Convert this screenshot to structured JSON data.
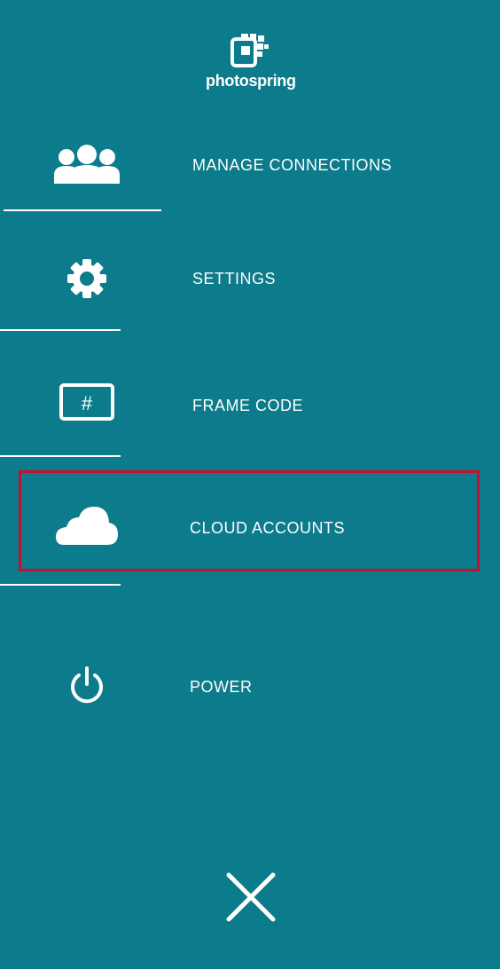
{
  "app": {
    "brand": "photospring"
  },
  "menu": {
    "items": [
      {
        "label": "MANAGE CONNECTIONS",
        "icon": "users-icon"
      },
      {
        "label": "SETTINGS",
        "icon": "gear-icon"
      },
      {
        "label": "FRAME CODE",
        "icon": "frame-code-icon"
      },
      {
        "label": "CLOUD ACCOUNTS",
        "icon": "cloud-icon",
        "highlighted": true
      },
      {
        "label": "POWER",
        "icon": "power-icon"
      }
    ],
    "frame_code_symbol": "#",
    "close_icon": "close-icon"
  },
  "colors": {
    "background": "#0c7b8b",
    "highlight": "#c8102e",
    "foreground": "#ffffff"
  }
}
